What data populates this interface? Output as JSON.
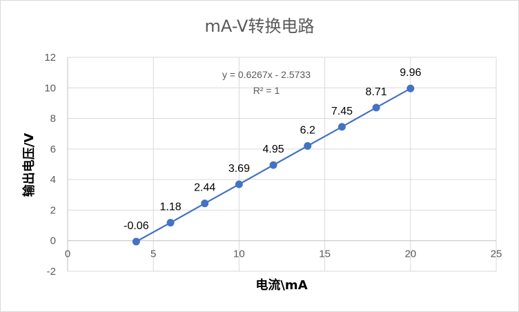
{
  "chart_data": {
    "type": "scatter",
    "title": "mA-V转换电路",
    "xlabel": "电流\\mA",
    "ylabel": "输出电压/V",
    "xlim": [
      0,
      25
    ],
    "ylim": [
      -2,
      12
    ],
    "x_ticks": [
      "0",
      "5",
      "10",
      "15",
      "20",
      "25"
    ],
    "y_ticks": [
      "-2",
      "0",
      "2",
      "4",
      "6",
      "8",
      "10",
      "12"
    ],
    "grid": true,
    "series": [
      {
        "x": [
          4,
          6,
          8,
          10,
          12,
          14,
          16,
          18,
          20
        ],
        "y": [
          -0.06,
          1.18,
          2.44,
          3.69,
          4.95,
          6.2,
          7.45,
          8.71,
          9.96
        ],
        "labels": [
          "-0.06",
          "1.18",
          "2.44",
          "3.69",
          "4.95",
          "6.2",
          "7.45",
          "8.71",
          "9.96"
        ],
        "color": "#4472c4"
      }
    ],
    "trendline": {
      "slope": 0.6267,
      "intercept": -2.5733,
      "equation": "y = 0.6267x - 2.5733",
      "r2": "R² = 1"
    }
  }
}
